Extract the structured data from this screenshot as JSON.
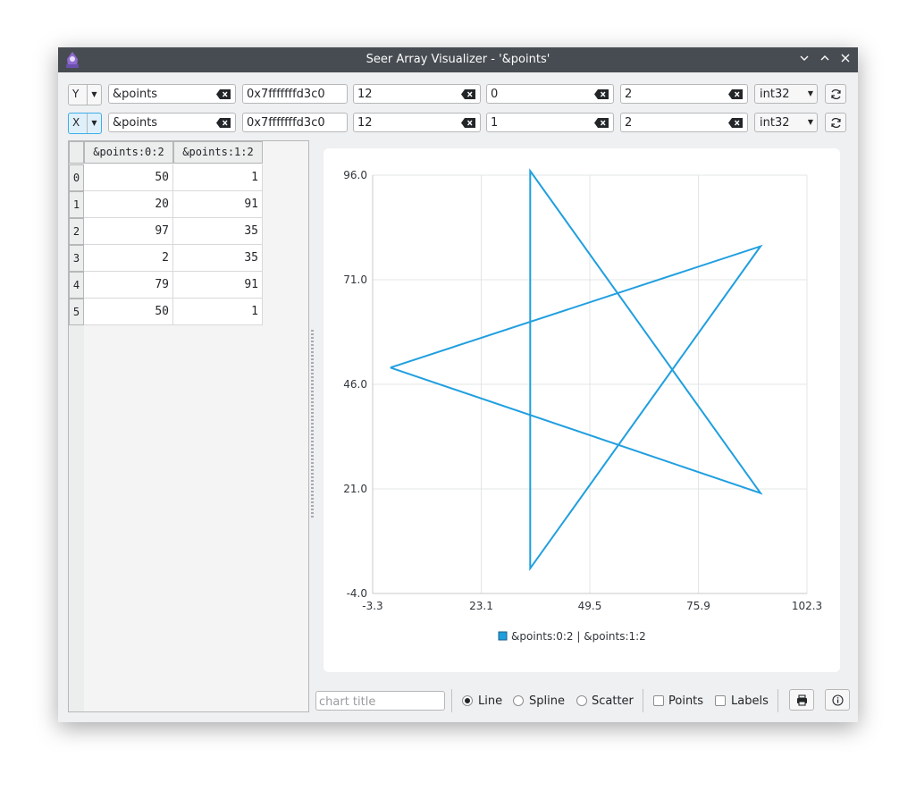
{
  "window": {
    "title": "Seer Array Visualizer - '&points'"
  },
  "rows": [
    {
      "axis": "Y",
      "variable": "&points",
      "address": "0x7fffffffd3c0",
      "count": "12",
      "offset": "0",
      "stride": "2",
      "type": "int32"
    },
    {
      "axis": "X",
      "variable": "&points",
      "address": "0x7fffffffd3c0",
      "count": "12",
      "offset": "1",
      "stride": "2",
      "type": "int32"
    }
  ],
  "table": {
    "headers": [
      "&points:0:2",
      "&points:1:2"
    ],
    "row_labels": [
      "0",
      "1",
      "2",
      "3",
      "4",
      "5"
    ],
    "rows": [
      [
        "50",
        "1"
      ],
      [
        "20",
        "91"
      ],
      [
        "97",
        "35"
      ],
      [
        "2",
        "35"
      ],
      [
        "79",
        "91"
      ],
      [
        "50",
        "1"
      ]
    ]
  },
  "bottom": {
    "title_placeholder": "chart title",
    "line_label": "Line",
    "spline_label": "Spline",
    "scatter_label": "Scatter",
    "points_label": "Points",
    "labels_label": "Labels"
  },
  "colors": {
    "series": "#209fdf",
    "titlebar": "#474c52",
    "accent": "#3daee9"
  },
  "chart_data": {
    "type": "line",
    "series": [
      {
        "name": "&points:0:2 | &points:1:2",
        "x": [
          1,
          91,
          35,
          35,
          91,
          1
        ],
        "y": [
          50,
          20,
          97,
          2,
          79,
          50
        ]
      }
    ],
    "x_ticks": [
      "-3.3",
      "23.1",
      "49.5",
      "75.9",
      "102.3"
    ],
    "y_ticks": [
      "96.0",
      "71.0",
      "46.0",
      "21.0",
      "-4.0"
    ],
    "xlim": [
      -3.3,
      102.3
    ],
    "ylim": [
      -4.0,
      96.0
    ],
    "grid": true,
    "legend": "bottom"
  }
}
